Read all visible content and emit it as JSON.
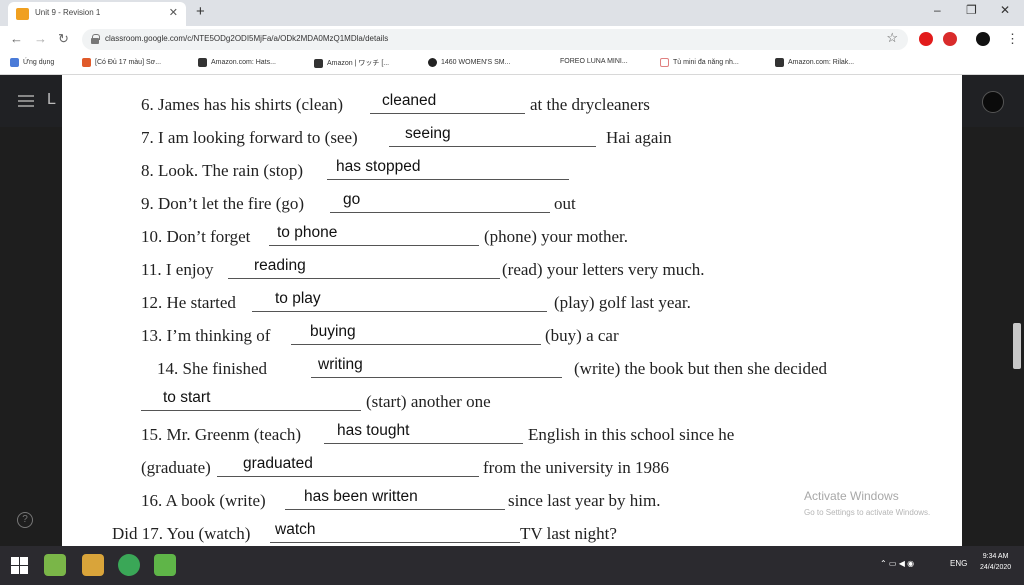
{
  "browser": {
    "tab_title": "Unit 9 - Revision 1",
    "url": "classroom.google.com/c/NTE5ODg2ODI5MjFa/a/ODk2MDA0MzQ1MDla/details"
  },
  "bookmarks": [
    "Ứng dụng",
    "[Có Đủ 17 màu] Sơ...",
    "Amazon.com: Hats...",
    "Amazon | ワッチ [...",
    "1460 WOMEN'S SM...",
    "FOREO LUNA MINI...",
    "Tủ mini đa năng nh...",
    "Amazon.com: Rilak..."
  ],
  "exercise": [
    {
      "pre": "6. James has his shirts (clean)",
      "answer": "cleaned",
      "post": "at the drycleaners"
    },
    {
      "pre": "7. I am looking forward to (see)",
      "answer": "seeing",
      "post": "Hai again"
    },
    {
      "pre": "8. Look. The rain (stop)",
      "answer": "has stopped",
      "post": ""
    },
    {
      "pre": "9. Don’t let the fire (go)",
      "answer": "go",
      "post": "out"
    },
    {
      "pre": "10. Don’t forget",
      "answer": "to phone",
      "post": "(phone) your mother."
    },
    {
      "pre": "11. I enjoy",
      "answer": "reading",
      "post": "(read) your letters very much."
    },
    {
      "pre": "12. He started",
      "answer": "to play",
      "post": "(play) golf last year."
    },
    {
      "pre": "13. I’m thinking of",
      "answer": "buying",
      "post": "(buy) a car"
    },
    {
      "pre": "14.  She  finished",
      "answer": "writing",
      "post": "(write)  the  book  but  then  she  decided"
    },
    {
      "pre": "",
      "answer": "to start",
      "post": "(start) another one"
    },
    {
      "pre": "15. Mr. Greenm (teach)",
      "answer": "has tought",
      "post": "English in this school since he"
    },
    {
      "pre": "(graduate)",
      "answer": "graduated",
      "post": "from the university in 1986"
    },
    {
      "pre": "16. A book (write)",
      "answer": "has been written",
      "post": "since last year by him."
    },
    {
      "pre": "Did 17. You (watch)",
      "answer": "watch",
      "post": "TV last night?"
    }
  ],
  "watermark": {
    "title": "Activate Windows",
    "subtitle": "Go to Settings to activate Windows."
  },
  "taskbar": {
    "lang": "ENG",
    "time": "9:34 AM",
    "date": "24/4/2020"
  }
}
